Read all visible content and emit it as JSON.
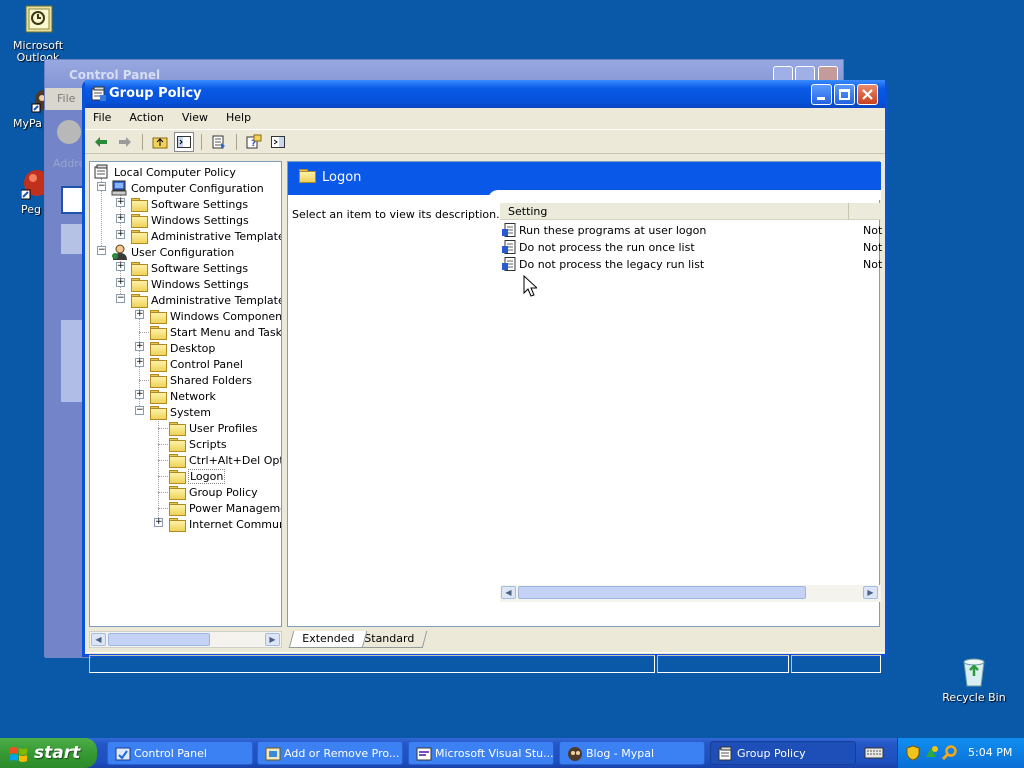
{
  "desktop": {
    "icons": [
      {
        "label": "Microsoft Outlook"
      },
      {
        "label": "MyPa"
      },
      {
        "label": "Peg"
      },
      {
        "label": "Recycle Bin"
      }
    ]
  },
  "background_window": {
    "title": "Control Panel",
    "menu_file": "File",
    "address_label": "Addre"
  },
  "window": {
    "title": "Group Policy",
    "menu": [
      "File",
      "Action",
      "View",
      "Help"
    ]
  },
  "tree": {
    "root": "Local Computer Policy",
    "computer_config": "Computer Configuration",
    "cc_software": "Software Settings",
    "cc_windows": "Windows Settings",
    "cc_admin": "Administrative Templates",
    "user_config": "User Configuration",
    "uc_software": "Software Settings",
    "uc_windows": "Windows Settings",
    "uc_admin": "Administrative Templates",
    "windows_components": "Windows Components",
    "start_menu": "Start Menu and Taskba",
    "desktop": "Desktop",
    "control_panel": "Control Panel",
    "shared_folders": "Shared Folders",
    "network": "Network",
    "system": "System",
    "user_profiles": "User Profiles",
    "scripts": "Scripts",
    "ctrl_alt_del": "Ctrl+Alt+Del Optio",
    "logon": "Logon",
    "group_policy": "Group Policy",
    "power_management": "Power Managemen",
    "internet_communication": "Internet Communic"
  },
  "details": {
    "banner_title": "Logon",
    "description": "Select an item to view its description.",
    "column_setting": "Setting",
    "rows": [
      {
        "setting": "Run these programs at user logon",
        "state": "Not"
      },
      {
        "setting": "Do not process the run once list",
        "state": "Not"
      },
      {
        "setting": "Do not process the legacy run list",
        "state": "Not"
      }
    ]
  },
  "tabs": {
    "extended": "Extended",
    "standard": "Standard"
  },
  "taskbar": {
    "start": "start",
    "tasks": [
      {
        "label": "Control Panel"
      },
      {
        "label": "Add or Remove Pro..."
      },
      {
        "label": "Microsoft Visual Stu..."
      },
      {
        "label": "Blog - Mypal"
      },
      {
        "label": "Group Policy"
      }
    ],
    "clock": "5:04 PM"
  },
  "colors": {
    "desktop_bg": "#0a58a8",
    "title_blue": "#0a52d8",
    "banner_blue": "#0a58e8",
    "window_face": "#ece9d8"
  }
}
